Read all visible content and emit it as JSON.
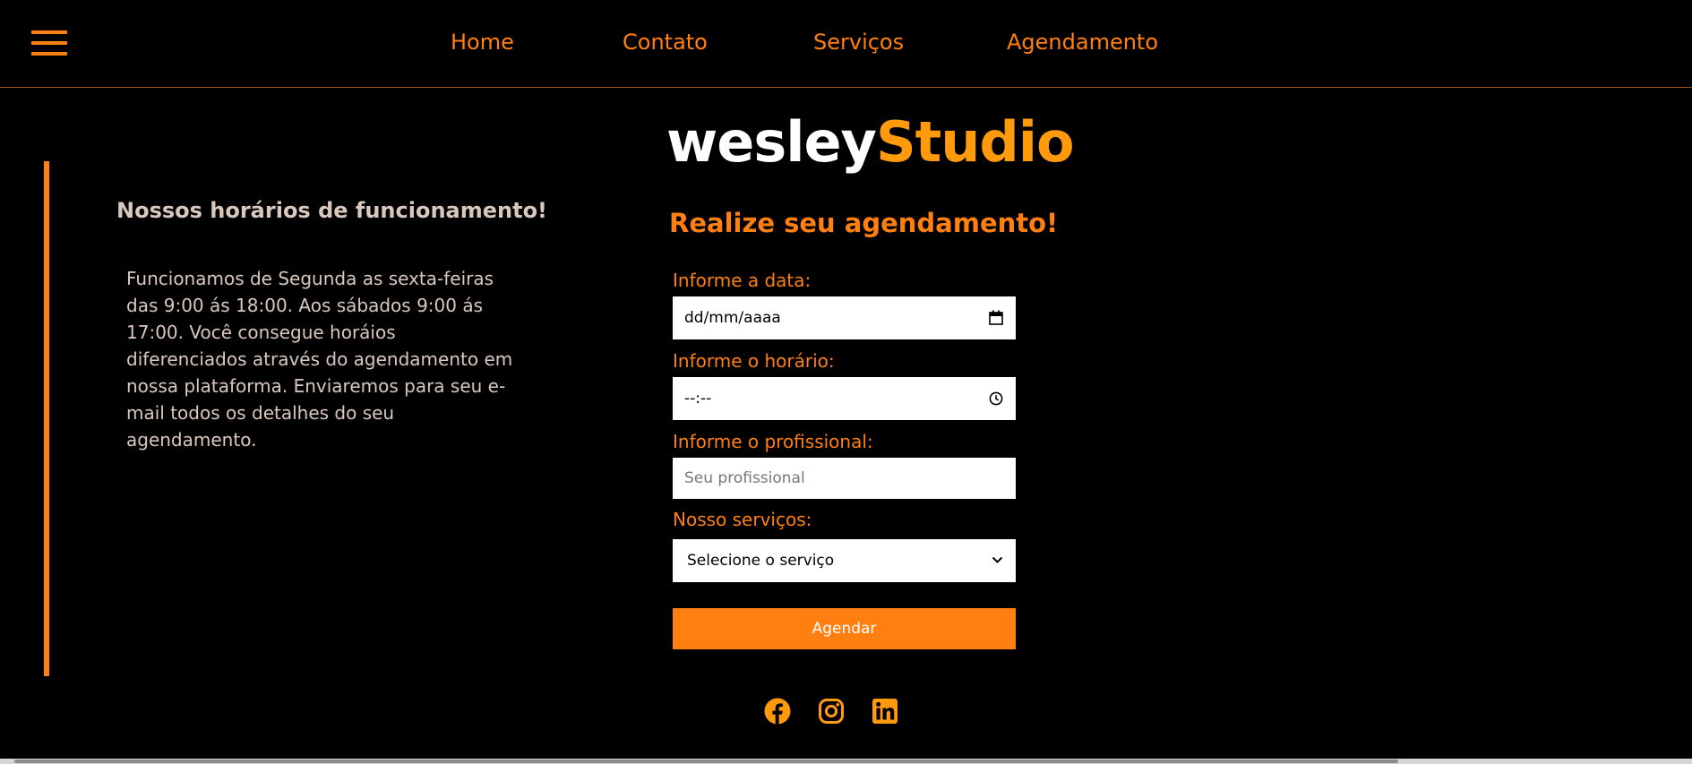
{
  "header": {
    "nav": [
      "Home",
      "Contato",
      "Serviços",
      "Agendamento"
    ]
  },
  "info": {
    "title": "Nossos horários de funcionamento!",
    "text": "Funcionamos de Segunda as sexta-feiras das 9:00 ás 18:00. Aos sábados 9:00 ás 17:00. Você consegue horáios diferenciados através do agendamento em nossa plataforma. Enviaremos para seu e-mail todos os detalhes do seu agendamento."
  },
  "brand": {
    "part1": "wesley",
    "part2": "Studio"
  },
  "form": {
    "title": "Realize seu agendamento!",
    "date_label": "Informe a data:",
    "date_value": "dd/mm/aaaa",
    "time_label": "Informe o horário:",
    "time_value": "--:--",
    "pro_label": "Informe o profissional:",
    "pro_placeholder": "Seu profissional",
    "service_label": "Nosso serviços:",
    "service_value": "Selecione o serviço",
    "submit": "Agendar"
  },
  "social": [
    "facebook-icon",
    "instagram-icon",
    "linkedin-icon"
  ],
  "colors": {
    "accent": "#ff7f11",
    "social": "#ff9a0d",
    "background": "#000000"
  }
}
